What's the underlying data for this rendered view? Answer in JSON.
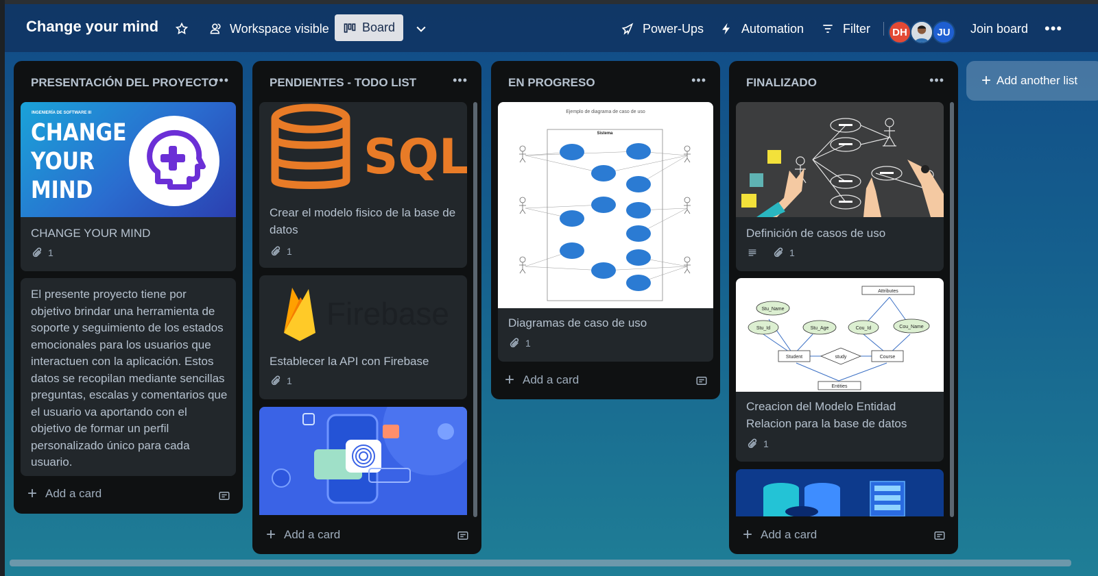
{
  "board": {
    "title": "Change your mind",
    "visibility_label": "Workspace visible",
    "view_label": "Board",
    "powerups_label": "Power-Ups",
    "automation_label": "Automation",
    "filter_label": "Filter",
    "join_label": "Join board",
    "members": [
      {
        "initials": "DH",
        "color": "#e34935"
      },
      {
        "initials": "",
        "color": "#cfd8e0"
      },
      {
        "initials": "JU",
        "color": "#1f5fd1"
      }
    ]
  },
  "lists": [
    {
      "title": "PRESENTACIÓN DEL PROYECTO",
      "add_card_label": "Add a card",
      "cards": [
        {
          "title": "CHANGE YOUR MIND",
          "attachments": "1",
          "cover": {
            "kicker": "INGENIERÍA DE SOFTWARE III",
            "line1": "CHANGE",
            "line2": "YOUR",
            "line3": "MIND"
          }
        },
        {
          "title": "El presente proyecto tiene por objetivo brindar una herramienta de soporte y seguimiento de los estados emocionales para los usuarios que interactuen con la aplicación. Estos datos se recopilan mediante sencillas preguntas, escalas y comentarios que el usuario va aportando con el objetivo de formar un perfil personalizado único para cada usuario."
        }
      ]
    },
    {
      "title": "PENDIENTES - TODO LIST",
      "add_card_label": "Add a card",
      "cards": [
        {
          "title": "Crear el modelo fisico de la base de datos",
          "attachments": "1",
          "cover": {
            "text": "SQL"
          }
        },
        {
          "title": "Establecer la API con Firebase",
          "attachments": "1",
          "cover": {
            "text": "Firebase"
          }
        },
        {
          "title": "",
          "cover": {
            "kind": "fingerprint-illustration"
          }
        }
      ]
    },
    {
      "title": "EN PROGRESO",
      "add_card_label": "Add a card",
      "cards": [
        {
          "title": "Diagramas de caso de uso",
          "attachments": "1",
          "cover": {
            "heading": "Ejemplo de diagrama de caso de uso",
            "system": "Sistema"
          }
        }
      ]
    },
    {
      "title": "FINALIZADO",
      "add_card_label": "Add a card",
      "cards": [
        {
          "title": "Definición de casos de uso",
          "attachments": "1"
        },
        {
          "title": "Creacion del Modelo Entidad Relacion para la base de datos",
          "attachments": "1",
          "cover": {
            "entities": [
              "Student",
              "Course"
            ],
            "relation": "study",
            "attributes": [
              "Stu_Name",
              "Stu_Id",
              "Stu_Age",
              "Cou_Id",
              "Cou_Name"
            ],
            "labels": {
              "top": "Attributes",
              "bottom": "Entities"
            }
          }
        },
        {
          "title": "",
          "cover": {
            "kind": "database-illustration"
          }
        }
      ]
    }
  ],
  "add_list_label": "Add another list",
  "icons": [
    "star-icon",
    "people-icon",
    "board-icon",
    "chevron-down-icon",
    "rocket-icon",
    "bolt-icon",
    "filter-icon",
    "more-icon",
    "attachment-icon",
    "description-icon",
    "plus-icon",
    "card-template-icon"
  ]
}
